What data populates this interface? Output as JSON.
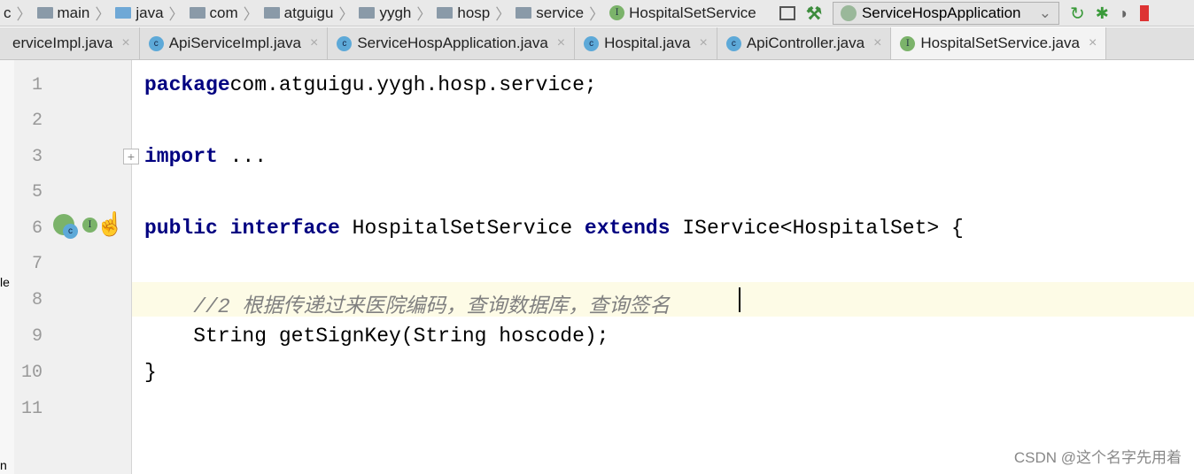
{
  "breadcrumb": [
    {
      "label": "c",
      "icon": "none"
    },
    {
      "label": "main",
      "icon": "folder-icon"
    },
    {
      "label": "java",
      "icon": "folder-blue-icon"
    },
    {
      "label": "com",
      "icon": "package-icon"
    },
    {
      "label": "atguigu",
      "icon": "package-icon"
    },
    {
      "label": "yygh",
      "icon": "package-icon"
    },
    {
      "label": "hosp",
      "icon": "package-icon"
    },
    {
      "label": "service",
      "icon": "package-icon"
    },
    {
      "label": "HospitalSetService",
      "icon": "interface-icon"
    }
  ],
  "toolbar": {
    "run_config": "ServiceHospApplication"
  },
  "tabs": [
    {
      "label": "erviceImpl.java",
      "icon": "none"
    },
    {
      "label": "ApiServiceImpl.java",
      "icon": "class-icon"
    },
    {
      "label": "ServiceHospApplication.java",
      "icon": "spring-class-icon"
    },
    {
      "label": "Hospital.java",
      "icon": "class-icon"
    },
    {
      "label": "ApiController.java",
      "icon": "class-icon"
    },
    {
      "label": "HospitalSetService.java",
      "icon": "interface-icon",
      "active": true
    }
  ],
  "side_text": {
    "a": "le",
    "b": "n"
  },
  "editor": {
    "lines": [
      {
        "n": "1",
        "parts": [
          [
            "kw",
            "package"
          ],
          [
            "",
            "com.atguigu.yygh.hosp.service;"
          ]
        ]
      },
      {
        "n": "2",
        "parts": []
      },
      {
        "n": "3",
        "parts": [
          [
            "kw",
            "import"
          ],
          [
            "",
            " ..."
          ]
        ]
      },
      {
        "n": "5",
        "parts": []
      },
      {
        "n": "6",
        "parts": [
          [
            "kw",
            "public"
          ],
          [
            "",
            " "
          ],
          [
            "kw",
            "interface"
          ],
          [
            "",
            " HospitalSetService "
          ],
          [
            "kw",
            "extends"
          ],
          [
            "",
            " IService<HospitalSet> {"
          ]
        ]
      },
      {
        "n": "7",
        "parts": []
      },
      {
        "n": "8",
        "parts": [
          [
            "cm",
            "    //2 根据传递过来医院编码，查询数据库，查询签名"
          ]
        ]
      },
      {
        "n": "9",
        "parts": [
          [
            "",
            "    String getSignKey(String hoscode);"
          ]
        ]
      },
      {
        "n": "10",
        "parts": [
          [
            "",
            "}"
          ]
        ]
      },
      {
        "n": "11",
        "parts": []
      }
    ],
    "current_line": "8"
  },
  "watermark": "CSDN @这个名字先用着"
}
